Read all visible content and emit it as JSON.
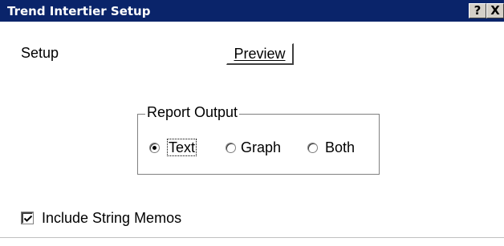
{
  "window": {
    "title": "Trend Intertier Setup",
    "help_label": "?",
    "close_label": "X"
  },
  "labels": {
    "setup": "Setup",
    "preview": "Preview"
  },
  "report_output": {
    "title": "Report Output",
    "options": [
      "Text",
      "Graph",
      "Both"
    ],
    "selected": "Text"
  },
  "include_string_memos": {
    "label": "Include String Memos",
    "checked": true
  },
  "colors": {
    "titlebar": "#0a246a",
    "title_text": "#ffffff"
  }
}
